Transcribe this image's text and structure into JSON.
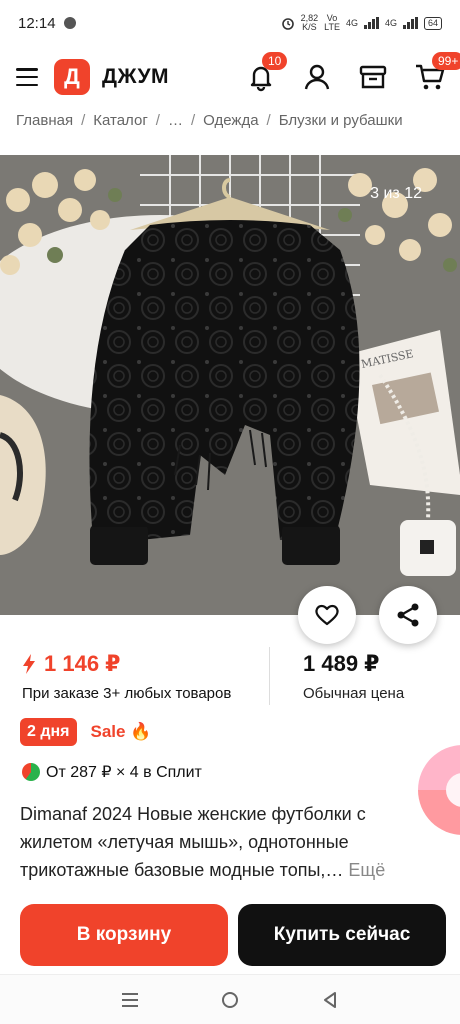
{
  "status_bar": {
    "time": "12:14",
    "speed_value": "2,82",
    "speed_unit": "K/S",
    "volte_top": "Vo",
    "volte_bottom": "LTE",
    "net1": "4G",
    "net2": "4G",
    "battery": "64"
  },
  "header": {
    "logo_letter": "Д",
    "brand": "ДЖУМ",
    "notifications_badge": "10",
    "cart_badge": "99+"
  },
  "breadcrumb": [
    "Главная",
    "Каталог",
    "…",
    "Одежда",
    "Блузки и рубашки"
  ],
  "gallery": {
    "counter": "3 из 12",
    "current": 3,
    "total": 12
  },
  "price": {
    "discount_price": "1 146 ₽",
    "discount_condition": "При заказе 3+ любых товаров",
    "regular_price": "1 489 ₽",
    "regular_label": "Обычная цена"
  },
  "tags": {
    "days": "2 дня",
    "sale": "Sale"
  },
  "split": {
    "text": "От 287 ₽ × 4 в Сплит"
  },
  "product": {
    "title": "Dimanaf 2024 Новые женские футболки с жилетом «летучая мышь», однотонные трикотажные базовые модные топы,…",
    "more": "Ещё"
  },
  "actions": {
    "add_to_cart": "В корзину",
    "buy_now": "Купить сейчас"
  },
  "colors": {
    "accent": "#f0432b",
    "dark": "#111111"
  }
}
